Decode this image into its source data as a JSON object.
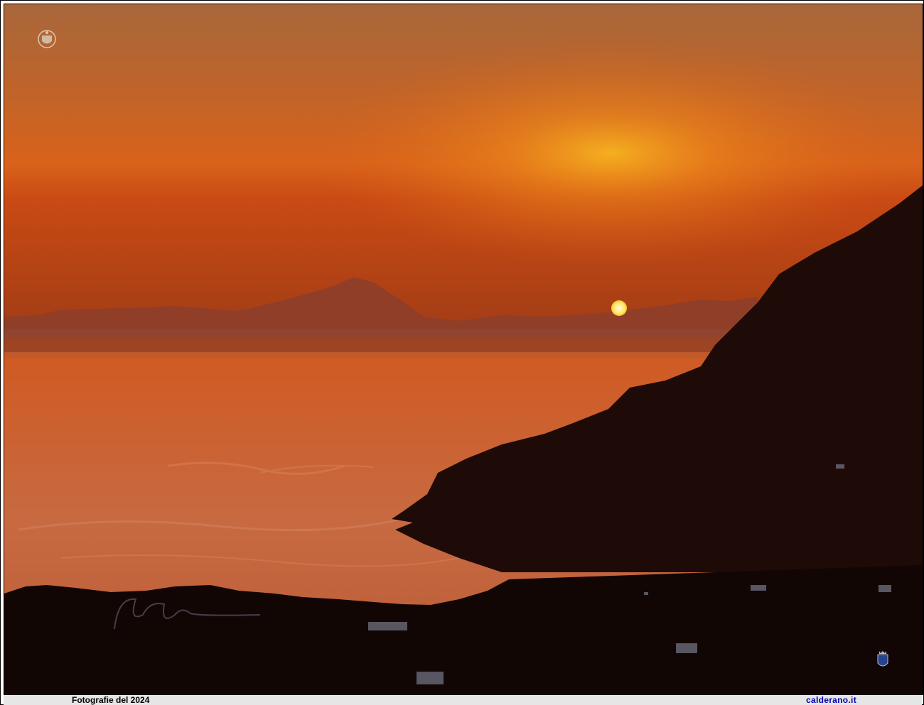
{
  "photo": {
    "description_visible": false
  },
  "footer": {
    "caption": "Fotografie del 2024",
    "site": "calderano.it",
    "site_color": "#0000b0"
  },
  "icons": {
    "top_left_logo": "crest-watermark-icon",
    "bottom_right_logo": "coat-of-arms-icon",
    "signature": "signature-watermark"
  }
}
